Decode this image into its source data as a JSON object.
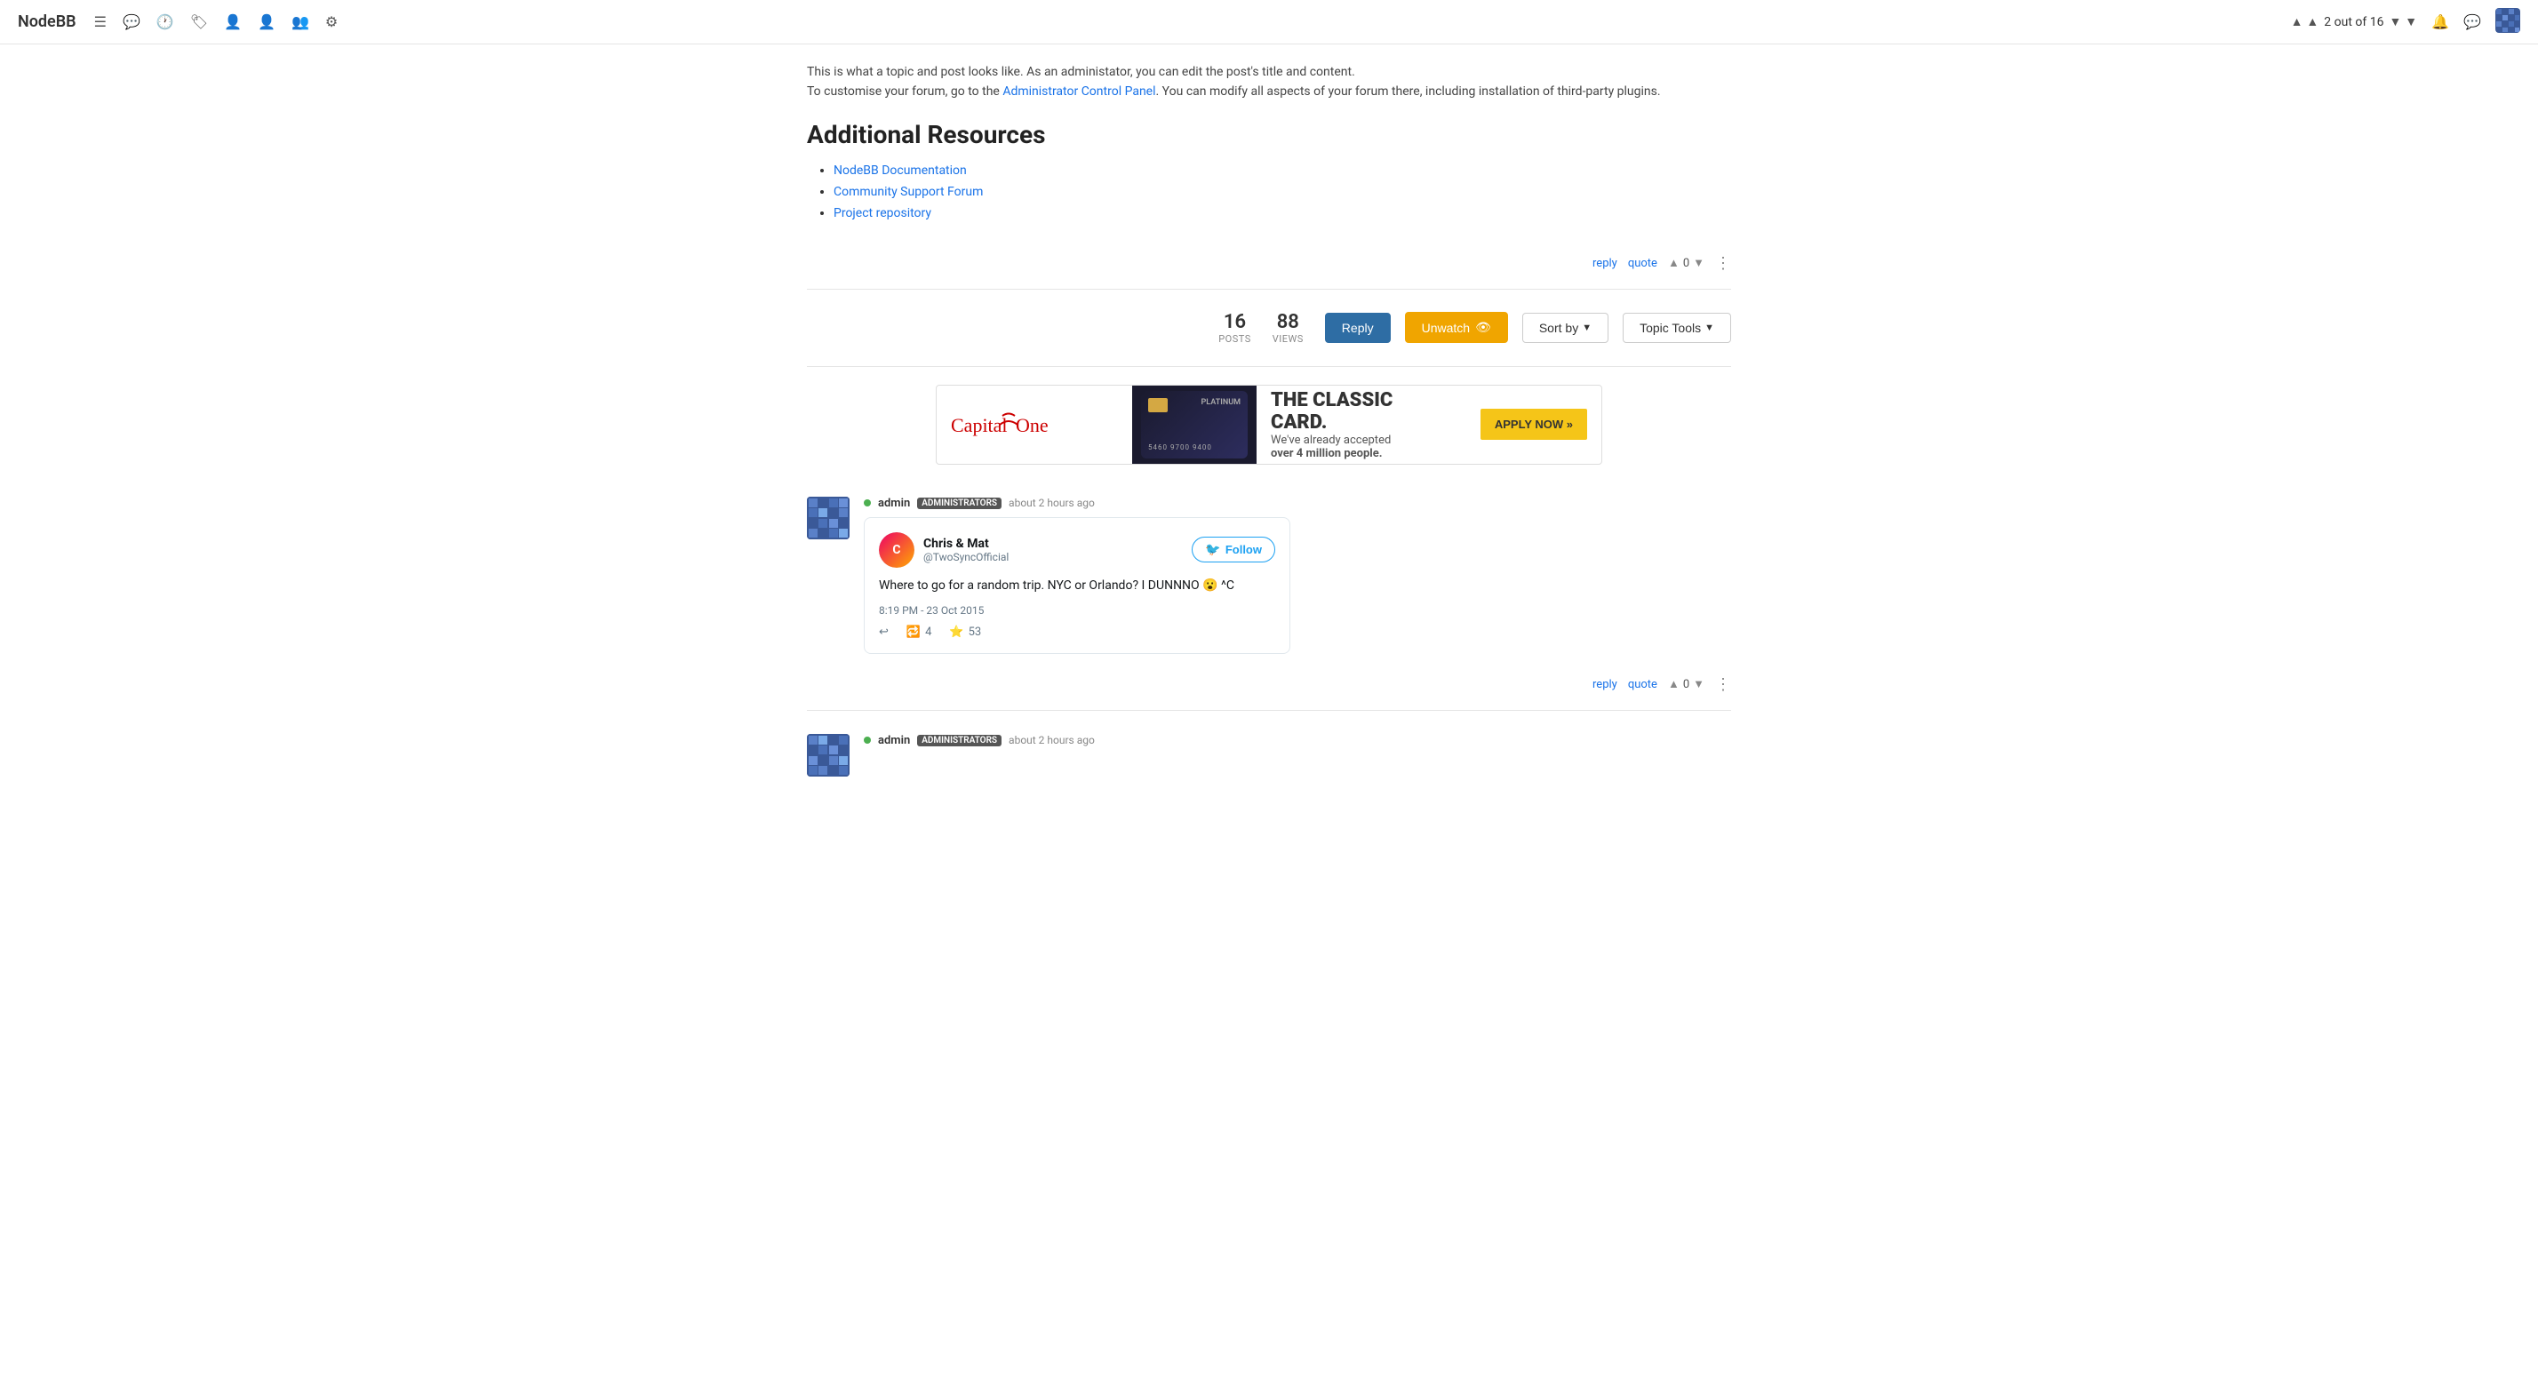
{
  "nav": {
    "brand": "NodeBB",
    "pager": {
      "current": "2 out of 16",
      "prev_icon": "▲",
      "next_icon": "▼"
    }
  },
  "post_intro": {
    "line1": "This is what a topic and post looks like. As an administator, you can edit the post's title and content.",
    "line2_prefix": "To customise your forum, go to the ",
    "link_text": "Administrator Control Panel",
    "line2_suffix": ". You can modify all aspects of your forum there, including installation of third-party plugins."
  },
  "additional_resources": {
    "heading": "Additional Resources",
    "links": [
      {
        "label": "NodeBB Documentation"
      },
      {
        "label": "Community Support Forum"
      },
      {
        "label": "Project repository"
      }
    ]
  },
  "post_actions_first": {
    "reply_label": "reply",
    "quote_label": "quote",
    "vote_count": "0"
  },
  "stats": {
    "posts_num": "16",
    "posts_label": "POSTS",
    "views_num": "88",
    "views_label": "VIEWS"
  },
  "action_buttons": {
    "reply": "Reply",
    "unwatch": "Unwatch",
    "sort_by": "Sort by",
    "topic_tools": "Topic Tools"
  },
  "ad": {
    "brand": "Capital One",
    "title": "THE CLASSIC CARD.",
    "subtitle_prefix": "We've already accepted",
    "subtitle_strong": "over 4 million people.",
    "cta": "APPLY NOW »",
    "card_numbers": "5460  9700  9400"
  },
  "post1": {
    "username": "admin",
    "badge": "ADMINISTRATORS",
    "time": "about 2 hours ago",
    "online": true
  },
  "tweet": {
    "author_name": "Chris & Mat",
    "author_handle": "@TwoSyncOfficial",
    "follow_label": "Follow",
    "text": "Where to go for a random trip. NYC or Orlando? I DUNNNO 😮\n^C",
    "timestamp": "8:19 PM - 23 Oct 2015",
    "retweet_count": "4",
    "like_count": "53"
  },
  "post_actions_second": {
    "reply_label": "reply",
    "quote_label": "quote",
    "vote_count": "0"
  },
  "post2": {
    "username": "admin",
    "badge": "ADMINISTRATORS",
    "time": "about 2 hours ago",
    "online": true
  }
}
